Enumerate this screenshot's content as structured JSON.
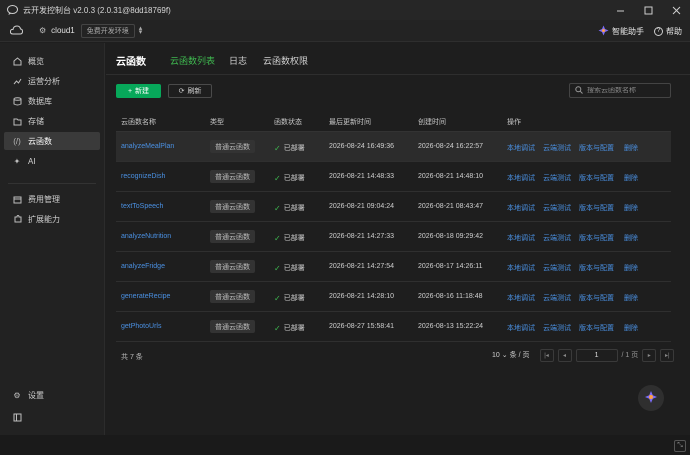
{
  "window": {
    "title": "云开发控制台 v2.0.3 (2.0.31@8dd18769f)",
    "controls": [
      "minimize",
      "maximize",
      "close"
    ]
  },
  "env": {
    "name": "cloud1",
    "badge": "免费开发环境",
    "assistant_label": "智能助手",
    "help_label": "帮助"
  },
  "sidebar": {
    "items": [
      {
        "label": "概览",
        "icon": "home-icon"
      },
      {
        "label": "运营分析",
        "icon": "chart-icon"
      },
      {
        "label": "数据库",
        "icon": "database-icon"
      },
      {
        "label": "存储",
        "icon": "folder-icon"
      },
      {
        "label": "云函数",
        "icon": "code-icon",
        "active": true
      },
      {
        "label": "AI",
        "icon": "sparkle-icon"
      },
      {
        "label": "费用管理",
        "icon": "wallet-icon"
      },
      {
        "label": "扩展能力",
        "icon": "puzzle-icon"
      }
    ],
    "settings_label": "设置"
  },
  "main": {
    "title": "云函数",
    "tabs": [
      {
        "label": "云函数列表",
        "active": true
      },
      {
        "label": "日志"
      },
      {
        "label": "云函数权限"
      }
    ],
    "new_button": "新建",
    "refresh_button": "刷新",
    "search_placeholder": "搜索云函数名称"
  },
  "table": {
    "headers": [
      "云函数名称",
      "类型",
      "函数状态",
      "最后更新时间",
      "创建时间",
      "操作"
    ],
    "rows": [
      {
        "name": "analyzeMealPlan",
        "type": "普通云函数",
        "status": "已部署",
        "updated": "2026-08-24 16:49:36",
        "created": "2026-08-24 16:22:57"
      },
      {
        "name": "recognizeDish",
        "type": "普通云函数",
        "status": "已部署",
        "updated": "2026-08-21 14:48:33",
        "created": "2026-08-21 14:48:10"
      },
      {
        "name": "textToSpeech",
        "type": "普通云函数",
        "status": "已部署",
        "updated": "2026-08-21 09:04:24",
        "created": "2026-08-21 08:43:47"
      },
      {
        "name": "analyzeNutrition",
        "type": "普通云函数",
        "status": "已部署",
        "updated": "2026-08-21 14:27:33",
        "created": "2026-08-18 09:29:42"
      },
      {
        "name": "analyzeFridge",
        "type": "普通云函数",
        "status": "已部署",
        "updated": "2026-08-21 14:27:54",
        "created": "2026-08-17 14:26:11"
      },
      {
        "name": "generateRecipe",
        "type": "普通云函数",
        "status": "已部署",
        "updated": "2026-08-21 14:28:10",
        "created": "2026-08-16 11:18:48"
      },
      {
        "name": "getPhotoUrls",
        "type": "普通云函数",
        "status": "已部署",
        "updated": "2026-08-27 15:58:41",
        "created": "2026-08-13 15:22:24"
      }
    ],
    "actions": [
      "本地调试",
      "云端测试",
      "版本与配置",
      "删除"
    ]
  },
  "pagination": {
    "total": "共 7 条",
    "page_size": "10",
    "per_page_suffix": "条 / 页",
    "current_page": "1",
    "total_pages": "/ 1 页"
  },
  "colors": {
    "accent_green": "#07a85a",
    "tab_active": "#3fb950",
    "link_blue": "#4a90e2"
  }
}
